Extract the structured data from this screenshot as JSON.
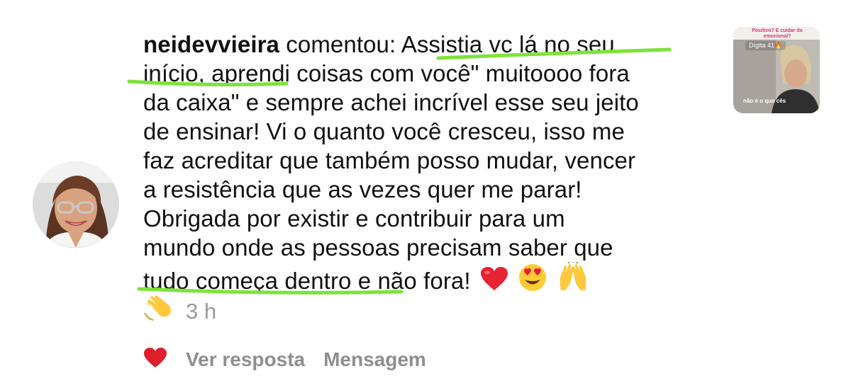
{
  "comment": {
    "username": "neidevvieira",
    "verb": "comentou:",
    "lines": [
      "Assistia vc lá no seu",
      "início, aprendi coisas com você\" muitoooo fora",
      "da caixa\" e sempre achei incrível esse seu jeito",
      "de ensinar! Vi o quanto você cresceu, isso me",
      "faz acreditar que também posso mudar, vencer",
      "a resistência que as vezes quer me parar!",
      "Obrigada por existir e contribuir para um",
      "mundo onde as pessoas precisam saber que",
      "tudo começa dentro e não fora!"
    ],
    "highlight_color": "#7de33a"
  },
  "meta": {
    "time": "3 h"
  },
  "actions": {
    "reply": "Ver resposta",
    "message": "Mensagem"
  },
  "thumbnail": {
    "top_text": "Positivo? E cuidar do emocional?",
    "tag": "Dígita 41🔥",
    "bottom_text": "não é o que cês"
  },
  "colors": {
    "heart": "#e01e2b",
    "muted_text": "#9a9a9a",
    "text": "#111111"
  }
}
